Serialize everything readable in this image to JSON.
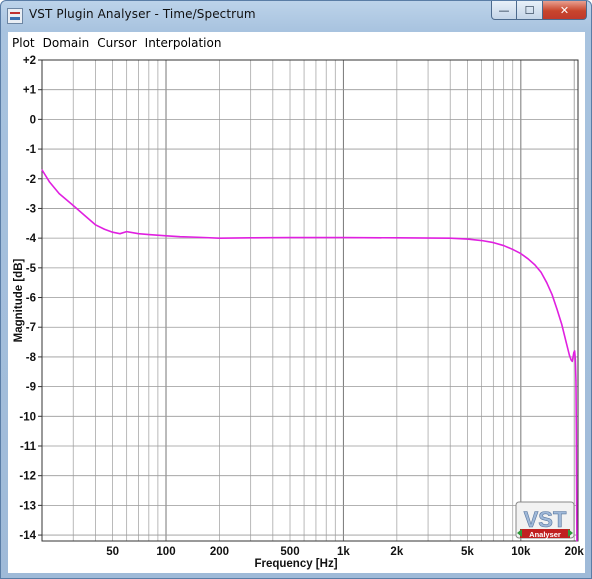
{
  "window": {
    "title": "VST Plugin Analyser - Time/Spectrum",
    "app_icon": "analyser-app-icon",
    "controls": {
      "minimize": "—",
      "maximize": "☐",
      "close": "✕"
    }
  },
  "menu": {
    "items": [
      "Plot",
      "Domain",
      "Cursor",
      "Interpolation"
    ]
  },
  "logo": {
    "text": "VST",
    "subtext": "Analyser"
  },
  "chart_data": {
    "type": "line",
    "xlabel": "Frequency [Hz]",
    "ylabel": "Magnitude [dB]",
    "x_scale": "log",
    "xlim": [
      20,
      21000
    ],
    "ylim": [
      -14.2,
      2
    ],
    "grid": true,
    "x_ticks": [
      {
        "value": 50,
        "label": "50"
      },
      {
        "value": 100,
        "label": "100"
      },
      {
        "value": 200,
        "label": "200"
      },
      {
        "value": 500,
        "label": "500"
      },
      {
        "value": 1000,
        "label": "1k"
      },
      {
        "value": 2000,
        "label": "2k"
      },
      {
        "value": 5000,
        "label": "5k"
      },
      {
        "value": 10000,
        "label": "10k"
      },
      {
        "value": 20000,
        "label": "20k"
      }
    ],
    "y_ticks": [
      {
        "value": 2,
        "label": "+2"
      },
      {
        "value": 1,
        "label": "+1"
      },
      {
        "value": 0,
        "label": "0"
      },
      {
        "value": -1,
        "label": "-1"
      },
      {
        "value": -2,
        "label": "-2"
      },
      {
        "value": -3,
        "label": "-3"
      },
      {
        "value": -4,
        "label": "-4"
      },
      {
        "value": -5,
        "label": "-5"
      },
      {
        "value": -6,
        "label": "-6"
      },
      {
        "value": -7,
        "label": "-7"
      },
      {
        "value": -8,
        "label": "-8"
      },
      {
        "value": -9,
        "label": "-9"
      },
      {
        "value": -10,
        "label": "-10"
      },
      {
        "value": -11,
        "label": "-11"
      },
      {
        "value": -12,
        "label": "-12"
      },
      {
        "value": -13,
        "label": "-13"
      },
      {
        "value": -14,
        "label": "-14"
      }
    ],
    "series": [
      {
        "color": "#e020e0",
        "x": [
          20,
          22,
          25,
          30,
          35,
          40,
          45,
          50,
          55,
          60,
          70,
          80,
          100,
          120,
          150,
          200,
          300,
          500,
          1000,
          2000,
          4000,
          5000,
          6000,
          7000,
          8000,
          9000,
          10000,
          11000,
          12000,
          13000,
          14000,
          15000,
          16000,
          17000,
          18000,
          18800,
          19200,
          19500,
          19700,
          19900,
          20100,
          20300,
          20450,
          20550,
          20600,
          20650,
          20700
        ],
        "y": [
          -1.7,
          -2.1,
          -2.5,
          -2.9,
          -3.25,
          -3.55,
          -3.7,
          -3.8,
          -3.85,
          -3.78,
          -3.85,
          -3.88,
          -3.92,
          -3.95,
          -3.97,
          -4.0,
          -3.99,
          -3.98,
          -3.98,
          -3.99,
          -4.0,
          -4.03,
          -4.08,
          -4.15,
          -4.25,
          -4.38,
          -4.52,
          -4.7,
          -4.9,
          -5.15,
          -5.5,
          -5.9,
          -6.4,
          -6.9,
          -7.5,
          -7.95,
          -8.1,
          -8.15,
          -8.0,
          -7.85,
          -7.8,
          -8.1,
          -8.8,
          -10.5,
          -12.0,
          -13.3,
          -14.2
        ]
      }
    ]
  }
}
